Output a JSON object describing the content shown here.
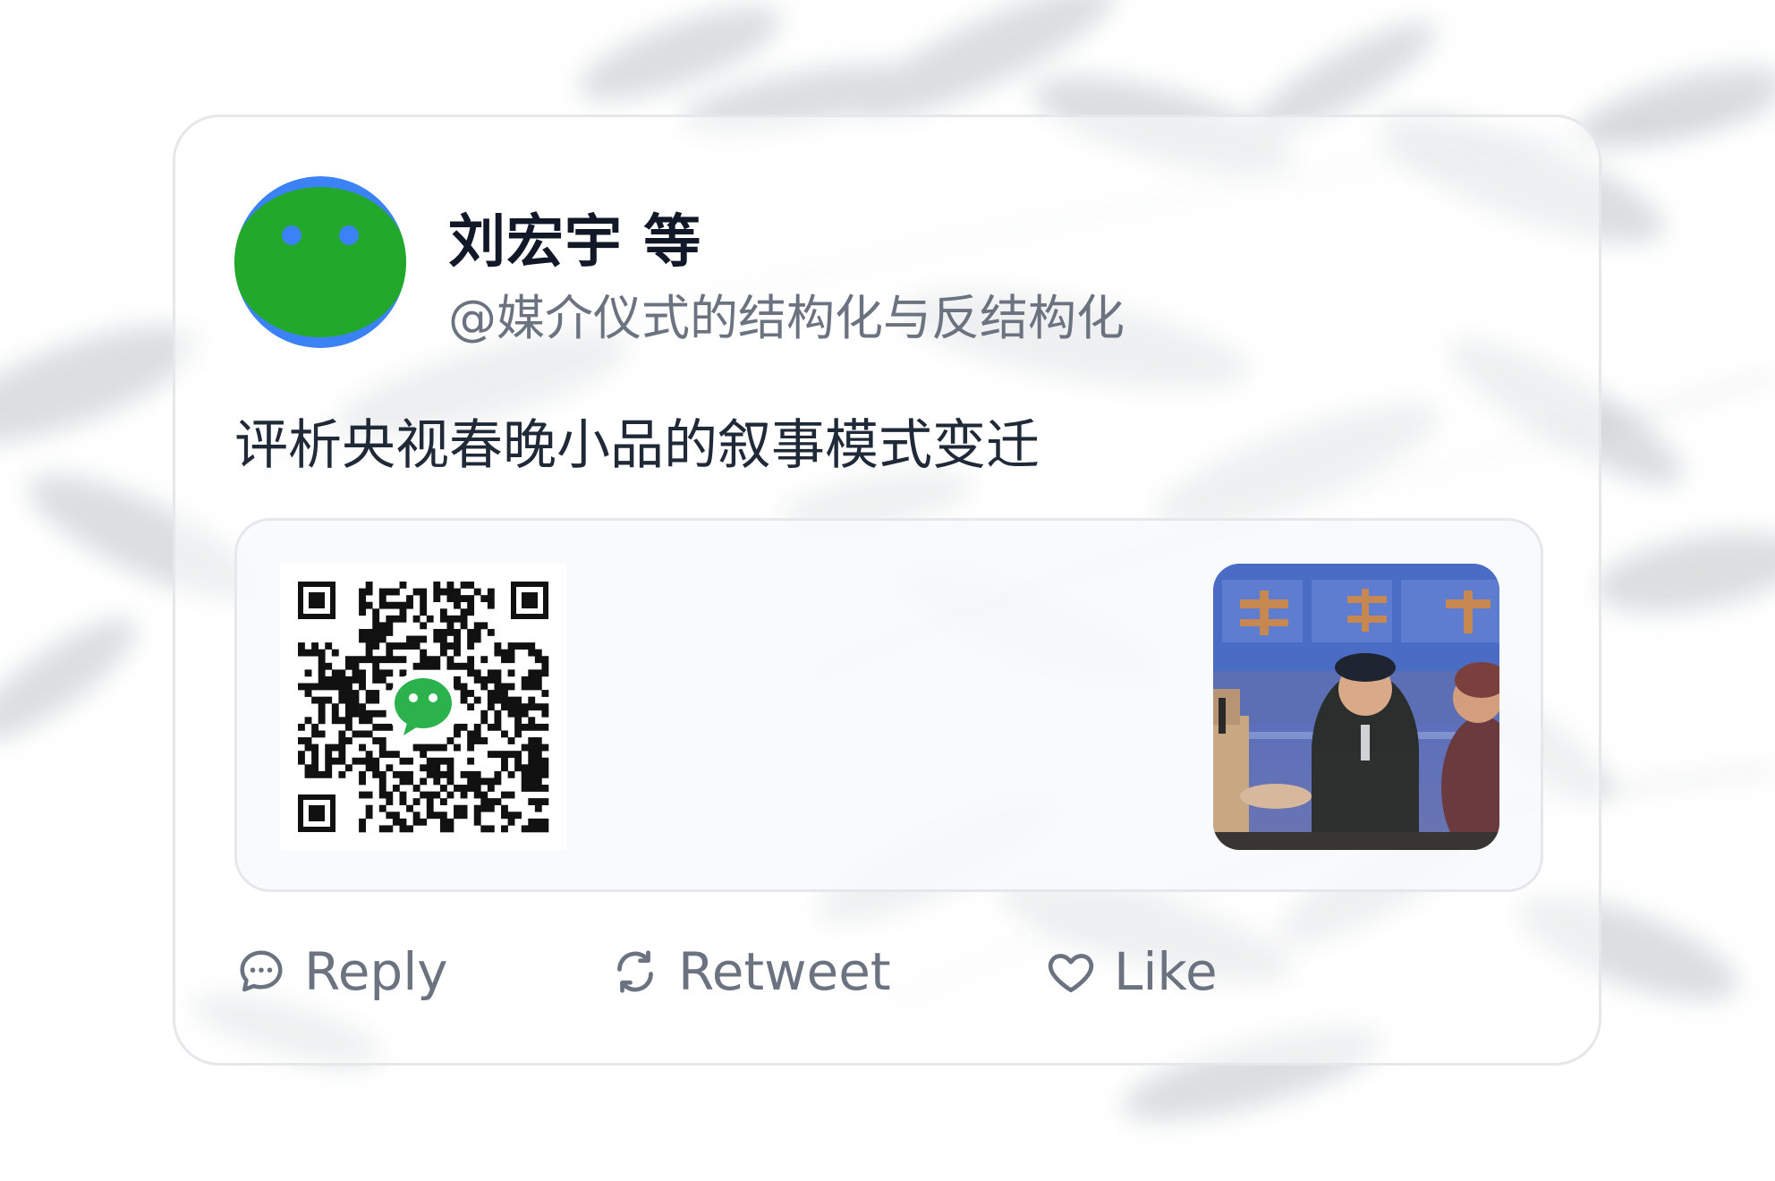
{
  "tweet": {
    "author_name": "刘宏宇 等",
    "author_handle": "@媒介仪式的结构化与反结构化",
    "text": "评析央视春晚小品的叙事模式变迁"
  },
  "media": {
    "qr_logo_icon": "wechat-logo-icon",
    "photo": "stage-performance-photo"
  },
  "actions": {
    "reply_label": "Reply",
    "retweet_label": "Retweet",
    "like_label": "Like"
  },
  "colors": {
    "card_border": "#e6e7ea",
    "name_text": "#111827",
    "secondary_text": "#6b7280",
    "wechat_green": "#22a82a",
    "avatar_ring_blue": "#3b82f6"
  }
}
